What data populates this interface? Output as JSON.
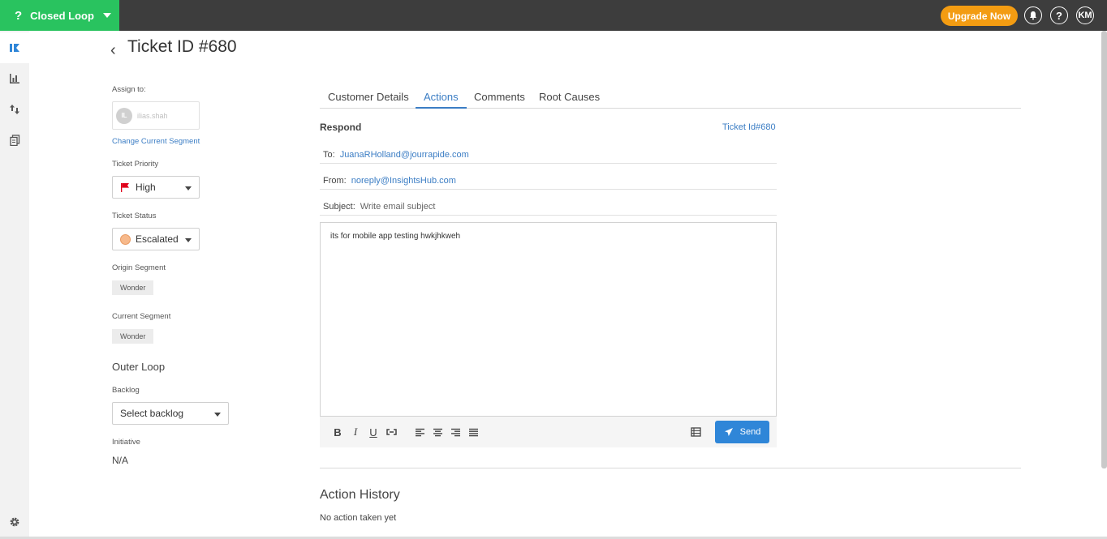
{
  "app": {
    "brand": "Closed Loop",
    "upgrade_label": "Upgrade Now",
    "user_initials": "KM"
  },
  "header": {
    "title": "Ticket ID #680"
  },
  "sidebar": {
    "assign_label": "Assign to:",
    "assignee_initials": "IL",
    "assignee_name": "ilias.shah",
    "change_segment": "Change Current Segment",
    "priority_label": "Ticket Priority",
    "priority_value": "High",
    "status_label": "Ticket Status",
    "status_value": "Escalated",
    "origin_label": "Origin Segment",
    "origin_value": "Wonder",
    "current_label": "Current Segment",
    "current_value": "Wonder",
    "outer_loop": "Outer Loop",
    "backlog_label": "Backlog",
    "backlog_placeholder": "Select backlog",
    "initiative_label": "Initiative",
    "initiative_value": "N/A"
  },
  "tabs": [
    {
      "label": "Customer Details"
    },
    {
      "label": "Actions",
      "active": true
    },
    {
      "label": "Comments"
    },
    {
      "label": "Root Causes"
    }
  ],
  "respond": {
    "heading": "Respond",
    "ticket_ref": "Ticket Id#680",
    "to_label": "To:",
    "to_value": "JuanaRHolland@jourrapide.com",
    "from_label": "From:",
    "from_value": "noreply@InsightsHub.com",
    "subject_label": "Subject:",
    "subject_placeholder": "Write email subject",
    "body": "its for mobile app testing hwkjhkweh",
    "send_label": "Send"
  },
  "history": {
    "heading": "Action History",
    "empty": "No action taken yet"
  },
  "colors": {
    "brand": "#29c35f",
    "accent": "#3b7dc4",
    "upgrade": "#f39c12",
    "send": "#2f86d8",
    "priority": "#e0001b"
  }
}
